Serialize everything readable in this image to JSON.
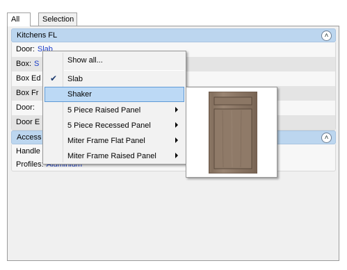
{
  "tabs": [
    {
      "label": "All",
      "active": true
    },
    {
      "label": "Selection",
      "active": false
    }
  ],
  "groups": [
    {
      "title": "Kitchens FL",
      "rows": [
        {
          "label": "Door:",
          "value": "Slab"
        },
        {
          "label": "Box:",
          "value": "S"
        },
        {
          "label": "Box Ed",
          "value": ""
        },
        {
          "label": "Box Fr",
          "value": ""
        },
        {
          "label": "Door:",
          "value": ""
        },
        {
          "label": "Door E",
          "value": ""
        }
      ]
    },
    {
      "title": "Access",
      "rows": [
        {
          "label": "Handle",
          "value": ""
        },
        {
          "label": "Profiles:",
          "value": "Aluminium"
        }
      ]
    }
  ],
  "context_menu": {
    "items": [
      {
        "label": "Show all...",
        "checked": false,
        "submenu": false,
        "highlighted": false
      },
      {
        "label": "Slab",
        "checked": true,
        "submenu": false,
        "highlighted": false
      },
      {
        "label": "Shaker",
        "checked": false,
        "submenu": false,
        "highlighted": true
      },
      {
        "label": "5 Piece Raised Panel",
        "checked": false,
        "submenu": true,
        "highlighted": false
      },
      {
        "label": "5 Piece Recessed Panel",
        "checked": false,
        "submenu": true,
        "highlighted": false
      },
      {
        "label": "Miter Frame Flat Panel",
        "checked": false,
        "submenu": true,
        "highlighted": false
      },
      {
        "label": "Miter Frame Raised Panel",
        "checked": false,
        "submenu": true,
        "highlighted": false
      }
    ]
  },
  "preview": {
    "icon": "shaker-door-preview-icon",
    "wood_color": "#8f7a68"
  },
  "colors": {
    "group_header": "#bcd6ef",
    "value_link": "#1a3cc8",
    "menu_highlight": "#bcd9f5"
  }
}
